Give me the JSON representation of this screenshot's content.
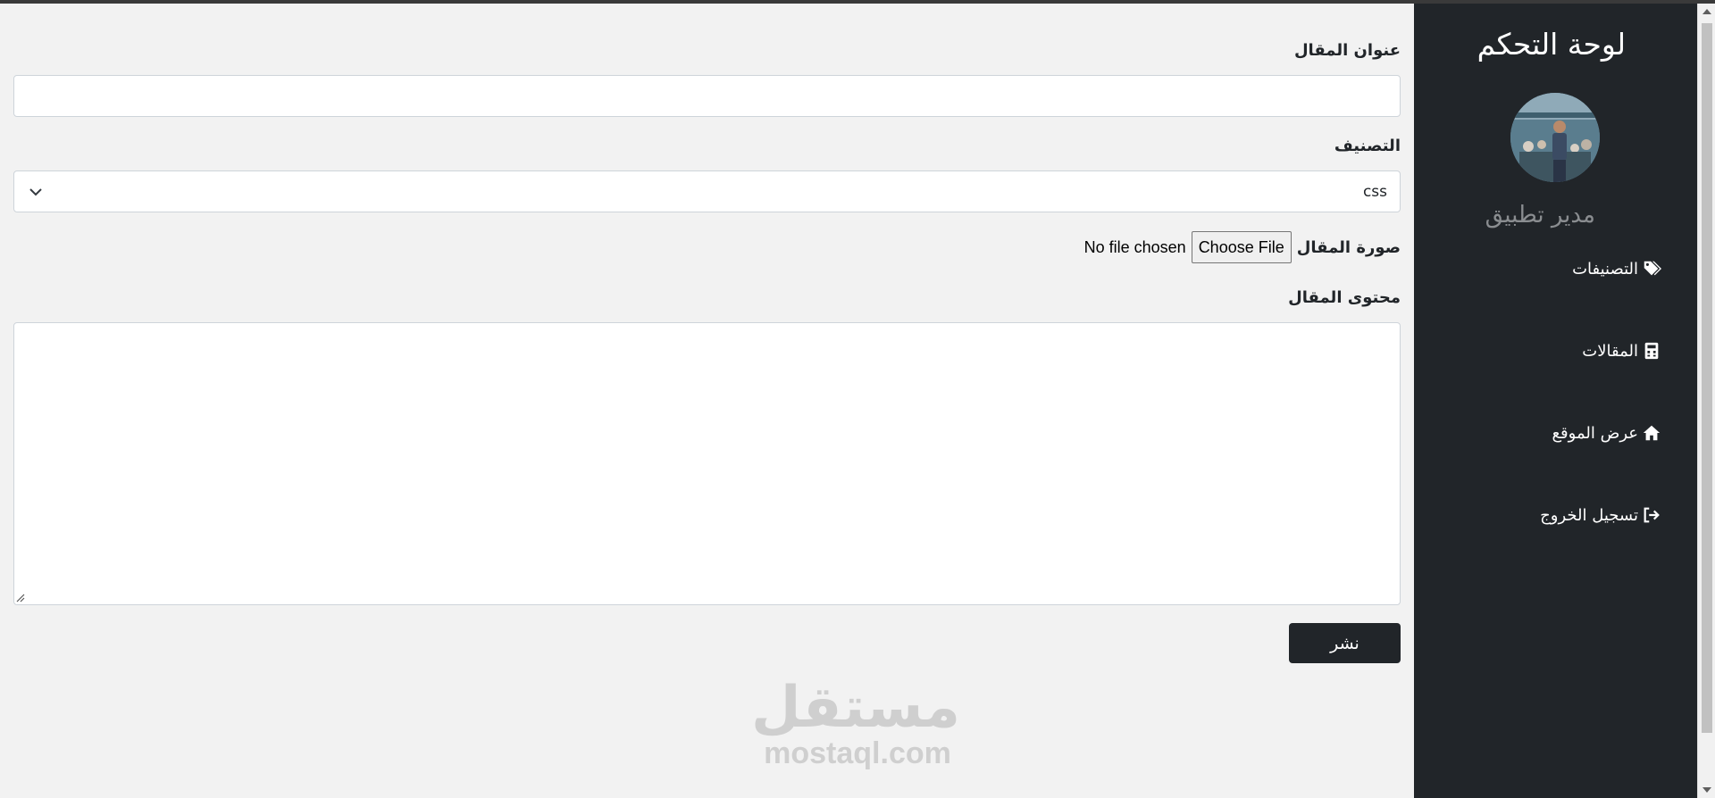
{
  "sidebar": {
    "title": "لوحة التحكم",
    "user_name": "مدير تطبيق",
    "items": [
      {
        "label": "التصنيفات",
        "icon": "tags-icon"
      },
      {
        "label": "المقالات",
        "icon": "calculator-icon"
      },
      {
        "label": "عرض الموقع",
        "icon": "home-icon"
      },
      {
        "label": "تسجيل الخروج",
        "icon": "logout-icon"
      }
    ]
  },
  "form": {
    "title_label": "عنوان المقال",
    "title_value": "",
    "category_label": "التصنيف",
    "category_value": "css",
    "image_label": "صورة المقال",
    "choose_file": "Choose File",
    "no_file": "No file chosen",
    "content_label": "محتوى المقال",
    "content_value": "",
    "submit": "نشر"
  },
  "watermark": {
    "arabic": "مستقل",
    "latin": "mostaql.com"
  },
  "colors": {
    "sidebar_bg": "#212529",
    "page_bg": "#f2f2f2",
    "button_bg": "#212529"
  }
}
